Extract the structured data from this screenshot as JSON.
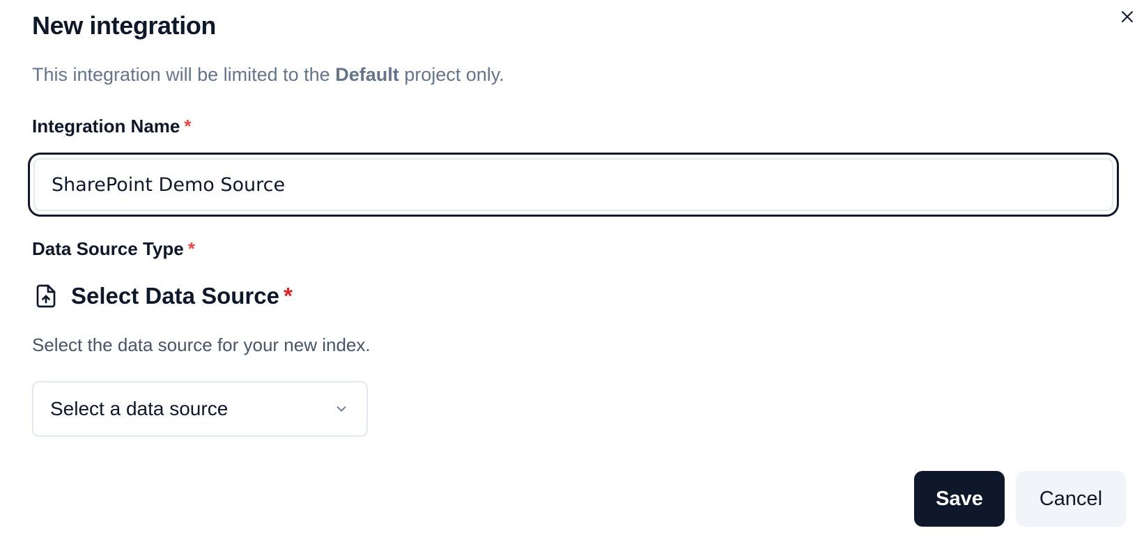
{
  "dialog": {
    "title": "New integration",
    "description_prefix": "This integration will be limited to the ",
    "description_project": "Default",
    "description_suffix": " project only.",
    "close_icon": "close-icon"
  },
  "integration_name": {
    "label": "Integration Name",
    "required_marker": "*",
    "value": "SharePoint Demo Source",
    "placeholder": ""
  },
  "data_source_type": {
    "label": "Data Source Type",
    "required_marker": "*",
    "section_icon": "file-upload-icon",
    "section_title": "Select Data Source",
    "section_required_marker": "*",
    "help_text": "Select the data source for your new index.",
    "select": {
      "value": "Select a data source",
      "chevron_icon": "chevron-down-icon"
    }
  },
  "footer": {
    "save_label": "Save",
    "cancel_label": "Cancel"
  },
  "colors": {
    "primary": "#0f172a",
    "required": "#ef4444",
    "muted_text": "#64748b",
    "secondary_button": "#f1f5f9",
    "border": "#e2e8f0"
  }
}
